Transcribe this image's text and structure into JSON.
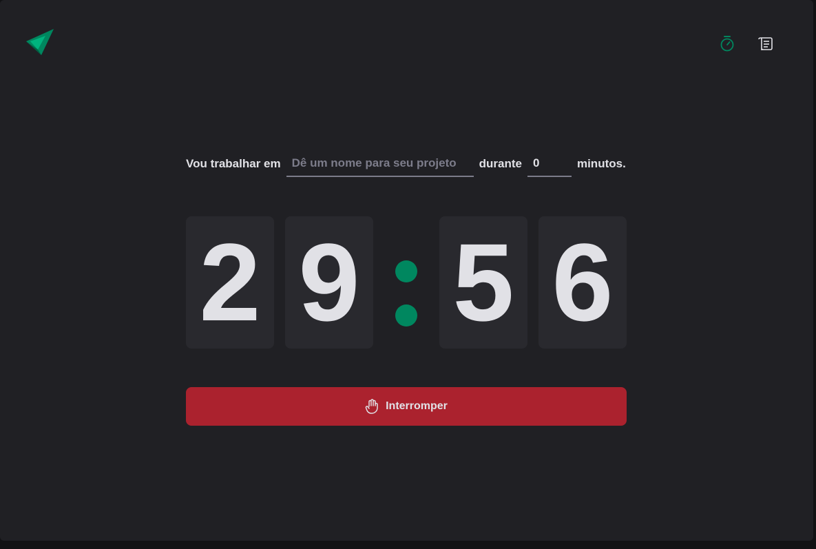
{
  "colors": {
    "background": "#202024",
    "accent": "#00875f",
    "danger": "#ab222e",
    "digit_background": "#29292e",
    "text": "#e1e1e6",
    "placeholder": "#7c7c8a"
  },
  "header": {
    "logo_icon": "paper-plane-logo-icon",
    "nav": [
      {
        "icon": "timer-icon",
        "active": true
      },
      {
        "icon": "scroll-icon",
        "active": false
      }
    ]
  },
  "task": {
    "prefix": "Vou trabalhar em",
    "project_placeholder": "Dê um nome para seu projeto",
    "project_value": "",
    "middle": "durante",
    "minutes_value": "0",
    "suffix": "minutos."
  },
  "countdown": {
    "minutes_tens": "2",
    "minutes_ones": "9",
    "seconds_tens": "5",
    "seconds_ones": "6"
  },
  "stop_button": {
    "label": "Interromper",
    "icon": "hand-palm-icon"
  }
}
